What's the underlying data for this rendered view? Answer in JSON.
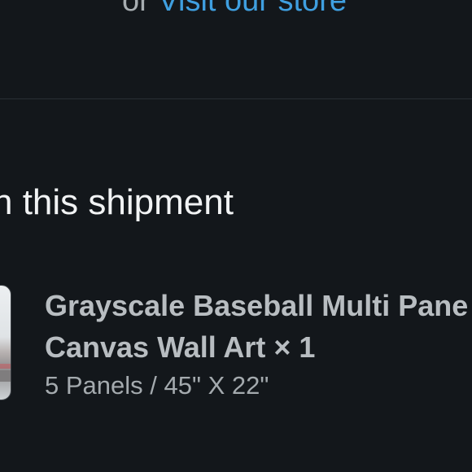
{
  "store_prompt": {
    "prefix": "or",
    "link_label": "Visit our store"
  },
  "shipment": {
    "heading": "n this shipment",
    "items": [
      {
        "title_line1": "Grayscale Baseball Multi Pane",
        "title_line2": "Canvas Wall Art × 1",
        "variant": "5 Panels / 45\" X 22\""
      }
    ]
  },
  "colors": {
    "background": "#13171b",
    "link": "#3f9fe0",
    "heading_text": "#f1f3f4",
    "item_text": "#b8bdc1"
  }
}
